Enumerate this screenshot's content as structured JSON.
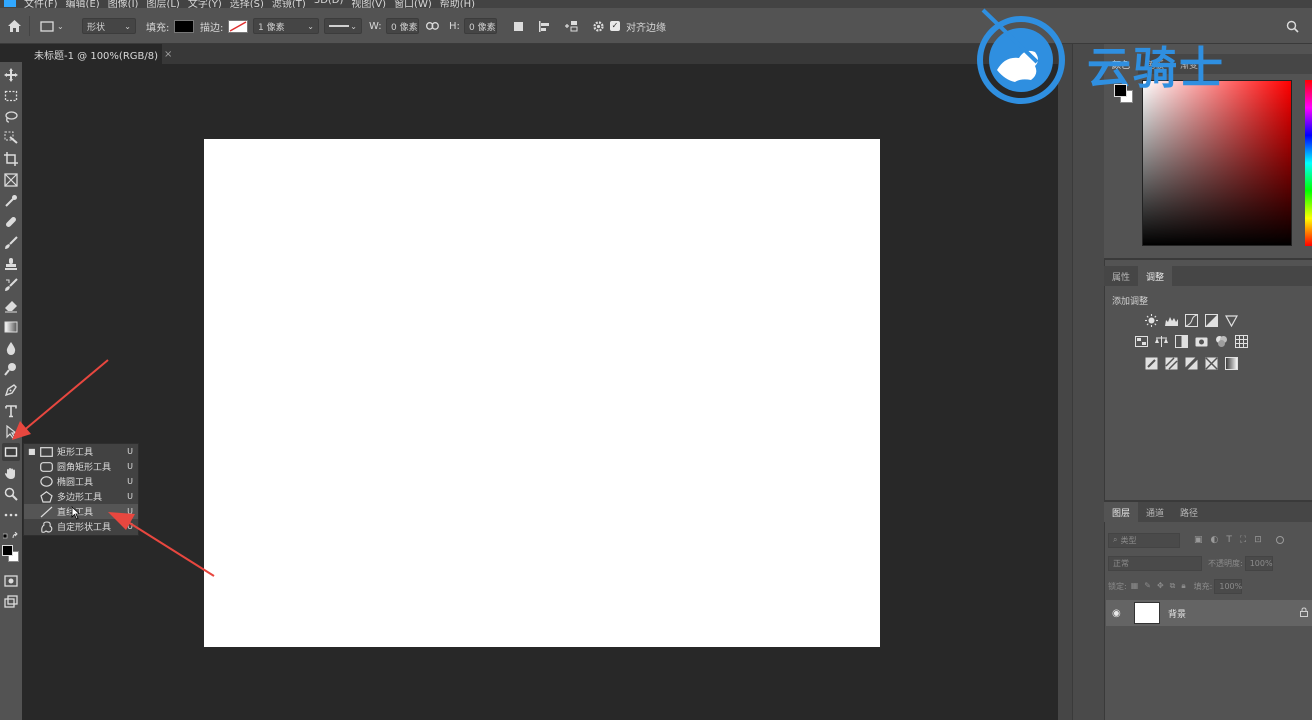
{
  "menubar": {
    "items": [
      "文件(F)",
      "编辑(E)",
      "图像(I)",
      "图层(L)",
      "文字(Y)",
      "选择(S)",
      "滤镜(T)",
      "3D(D)",
      "视图(V)",
      "窗口(W)",
      "帮助(H)"
    ]
  },
  "options": {
    "mode": "形状",
    "fill_label": "填充:",
    "stroke_label": "描边:",
    "stroke_width": "1 像素",
    "w_label": "W:",
    "w_value": "0 像素",
    "h_label": "H:",
    "h_value": "0 像素",
    "align_edges": "对齐边缘"
  },
  "document": {
    "tab_title": "未标题-1 @ 100%(RGB/8)",
    "close_glyph": "×"
  },
  "flyout": {
    "items": [
      {
        "label": "矩形工具",
        "key": "U"
      },
      {
        "label": "圆角矩形工具",
        "key": "U"
      },
      {
        "label": "椭圆工具",
        "key": "U"
      },
      {
        "label": "多边形工具",
        "key": "U"
      },
      {
        "label": "直线工具",
        "key": "U"
      },
      {
        "label": "自定形状工具",
        "key": "U"
      }
    ]
  },
  "color_panel": {
    "tabs": [
      "颜色",
      "色板",
      "渐变"
    ]
  },
  "adjust_panel": {
    "tabs": [
      "属性",
      "调整"
    ],
    "title": "添加调整"
  },
  "layers_panel": {
    "tabs": [
      "图层",
      "通道",
      "路径"
    ],
    "filter_placeholder": "类型",
    "blend_mode": "正常",
    "opacity_label": "不透明度:",
    "opacity_value": "100%",
    "lock_label": "锁定:",
    "fill_label": "填充:",
    "fill_value": "100%",
    "layer_name": "背景"
  },
  "watermark": {
    "text": "云骑士"
  },
  "colors": {
    "accent_blue": "#2f8fe0",
    "arrow_red": "#e8473f"
  }
}
